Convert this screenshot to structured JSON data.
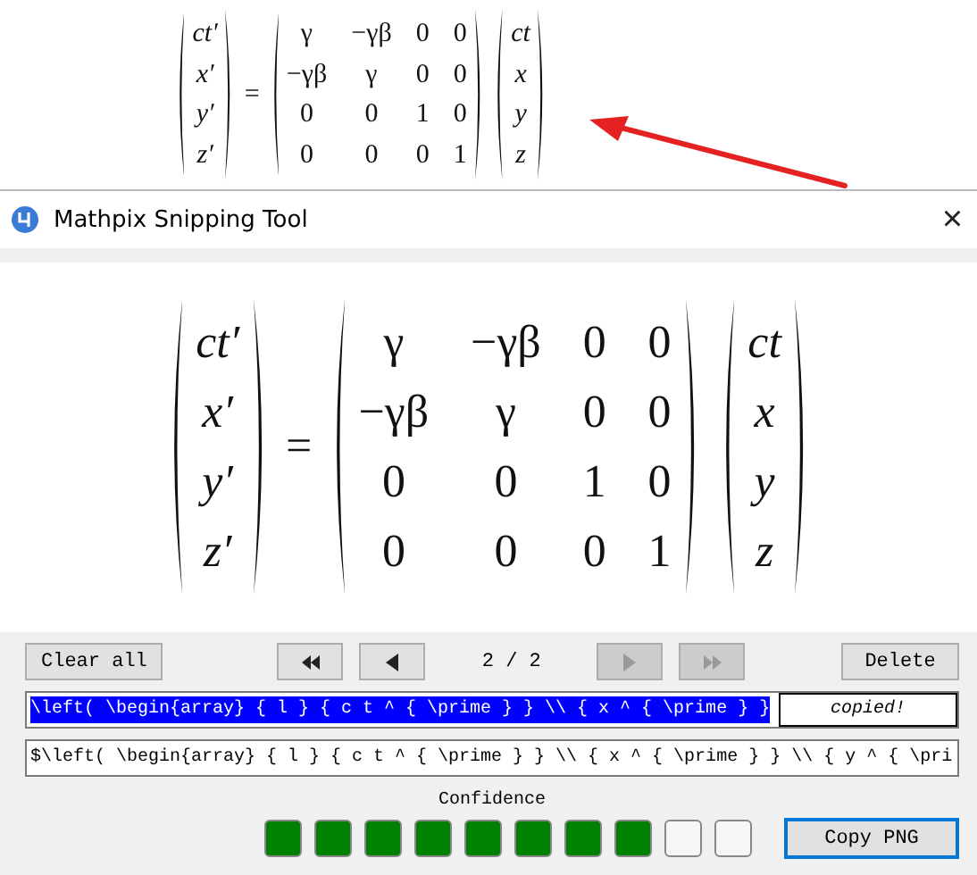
{
  "snippet": {
    "lhs": [
      "ct′",
      "x′",
      "y′",
      "z′"
    ],
    "equals": "=",
    "matrix": [
      [
        "γ",
        "−γβ",
        "0",
        "0"
      ],
      [
        "−γβ",
        "γ",
        "0",
        "0"
      ],
      [
        "0",
        "0",
        "1",
        "0"
      ],
      [
        "0",
        "0",
        "0",
        "1"
      ]
    ],
    "rhs": [
      "ct",
      "x",
      "y",
      "z"
    ]
  },
  "window": {
    "title": "Mathpix Snipping Tool",
    "close": "×"
  },
  "preview": {
    "lhs": [
      "ct′",
      "x′",
      "y′",
      "z′"
    ],
    "equals": "=",
    "matrix": [
      [
        "γ",
        "−γβ",
        "0",
        "0"
      ],
      [
        "−γβ",
        "γ",
        "0",
        "0"
      ],
      [
        "0",
        "0",
        "1",
        "0"
      ],
      [
        "0",
        "0",
        "0",
        "1"
      ]
    ],
    "rhs": [
      "ct",
      "x",
      "y",
      "z"
    ]
  },
  "toolbar": {
    "clear": "Clear all",
    "nav": [
      {
        "kind": "first",
        "disabled": false
      },
      {
        "kind": "prev",
        "disabled": false
      },
      {
        "kind": "next",
        "disabled": true
      },
      {
        "kind": "last",
        "disabled": true
      }
    ],
    "counter": "2 / 2",
    "delete": "Delete"
  },
  "outputs": [
    {
      "value": "\\left( \\begin{array} { l } { c t ^ { \\prime } } \\\\ { x ^ { \\prime } }",
      "selected": true,
      "badge": "copied!"
    },
    {
      "value": "$\\left( \\begin{array} { l } { c t ^ { \\prime } } \\\\ { x ^ { \\prime } } \\\\ { y ^ { \\pri",
      "selected": false
    }
  ],
  "confidence": {
    "label": "Confidence",
    "level": 0.8
  },
  "copy_png": "Copy PNG"
}
